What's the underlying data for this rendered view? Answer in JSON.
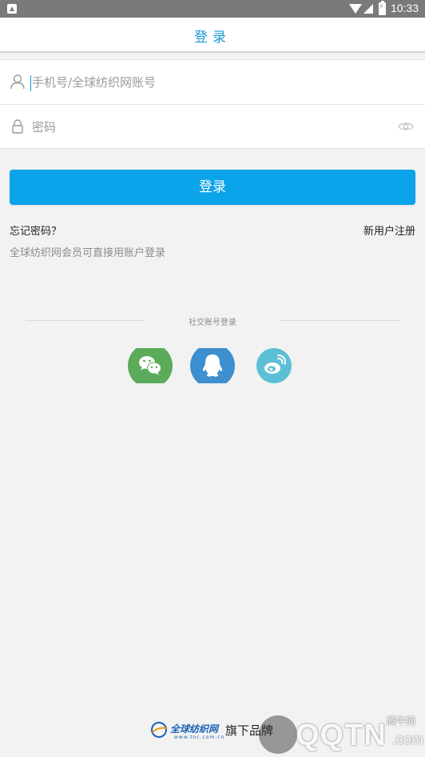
{
  "status_bar": {
    "time": "10:33"
  },
  "header": {
    "title": "登录"
  },
  "form": {
    "account_placeholder": "手机号/全球纺织网账号",
    "password_placeholder": "密码"
  },
  "login_button": "登录",
  "links": {
    "forgot": "忘记密码？",
    "register": "新用户注册"
  },
  "member_tip": "全球纺织网会员可直接用账户登录",
  "social": {
    "label": "社交账号登录",
    "items": [
      {
        "name": "wechat",
        "color": "#5cab5a"
      },
      {
        "name": "qq",
        "color": "#3d8fcf"
      },
      {
        "name": "weibo",
        "color": "#5cbfd6"
      }
    ]
  },
  "footer": {
    "brand": "全球纺织网",
    "url": "www.tnc.com.cn",
    "suffix": "旗下品牌"
  },
  "watermark": {
    "text": "QQTN",
    "domain": ".com",
    "cn": "腾牛网"
  },
  "colors": {
    "accent": "#0ba3ea",
    "title": "#1a9ad6"
  }
}
